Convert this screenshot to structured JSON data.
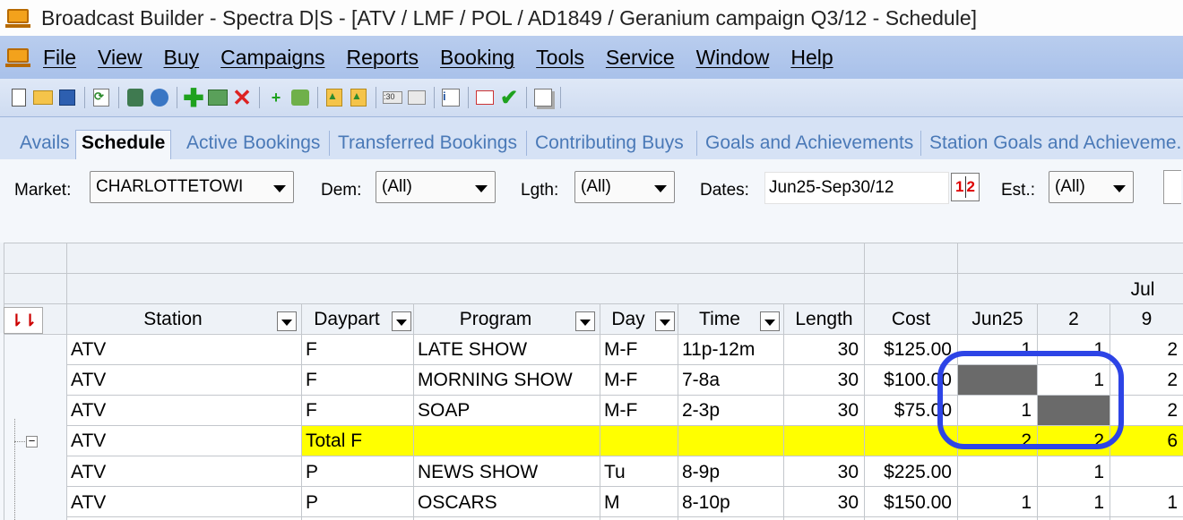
{
  "window": {
    "title": "Broadcast Builder - Spectra D|S - [ATV / LMF / POL / AD1849 / Geranium campaign Q3/12 - Schedule]"
  },
  "menu": {
    "items": [
      "File",
      "View",
      "Buy",
      "Campaigns",
      "Reports",
      "Booking",
      "Tools",
      "Service",
      "Window",
      "Help"
    ]
  },
  "tabs": [
    "Avails",
    "Schedule",
    "Active Bookings",
    "Transferred Bookings",
    "Contributing Buys",
    "Goals and Achievements",
    "Station Goals and Achieveme."
  ],
  "active_tab": "Schedule",
  "filters": {
    "market_label": "Market:",
    "market_value": "CHARLOTTETOWI",
    "dem_label": "Dem:",
    "dem_value": "(All)",
    "lgth_label": "Lgth:",
    "lgth_value": "(All)",
    "dates_label": "Dates:",
    "dates_value": "Jun25-Sep30/12",
    "calendar_left": "1",
    "calendar_right": "2",
    "est_label": "Est.:",
    "est_value": "(All)"
  },
  "grid": {
    "month_label": "Jul",
    "columns": [
      "Station",
      "Daypart",
      "Program",
      "Day",
      "Time",
      "Length",
      "Cost",
      "Jun25",
      "2",
      "9"
    ],
    "rows": [
      {
        "station": "ATV",
        "daypart": "F",
        "program": "LATE SHOW",
        "day": "M-F",
        "time": "11p-12m",
        "length": "30",
        "cost": "$125.00",
        "w1": "1",
        "w2": "1",
        "w3": "2",
        "type": "normal"
      },
      {
        "station": "ATV",
        "daypart": "F",
        "program": "MORNING SHOW",
        "day": "M-F",
        "time": "7-8a",
        "length": "30",
        "cost": "$100.00",
        "w1": "",
        "w2": "1",
        "w3": "2",
        "type": "normal",
        "blocked": "w1"
      },
      {
        "station": "ATV",
        "daypart": "F",
        "program": "SOAP",
        "day": "M-F",
        "time": "2-3p",
        "length": "30",
        "cost": "$75.00",
        "w1": "1",
        "w2": "",
        "w3": "2",
        "type": "normal",
        "blocked": "w2"
      },
      {
        "station": "ATV",
        "daypart": "Total F",
        "program": "",
        "day": "",
        "time": "",
        "length": "",
        "cost": "",
        "w1": "2",
        "w2": "2",
        "w3": "6",
        "type": "total"
      },
      {
        "station": "ATV",
        "daypart": "P",
        "program": "NEWS SHOW",
        "day": "Tu",
        "time": "8-9p",
        "length": "30",
        "cost": "$225.00",
        "w1": "",
        "w2": "1",
        "w3": "",
        "type": "normal"
      },
      {
        "station": "ATV",
        "daypart": "P",
        "program": "OSCARS",
        "day": "M",
        "time": "8-10p",
        "length": "30",
        "cost": "$150.00",
        "w1": "1",
        "w2": "1",
        "w3": "1",
        "type": "normal"
      }
    ]
  },
  "colors": {
    "total_row": "#ffff00",
    "blocked_cell": "#6a6a6a",
    "annotation_ring": "#2d44e6",
    "tab_text": "#4a79b7"
  }
}
